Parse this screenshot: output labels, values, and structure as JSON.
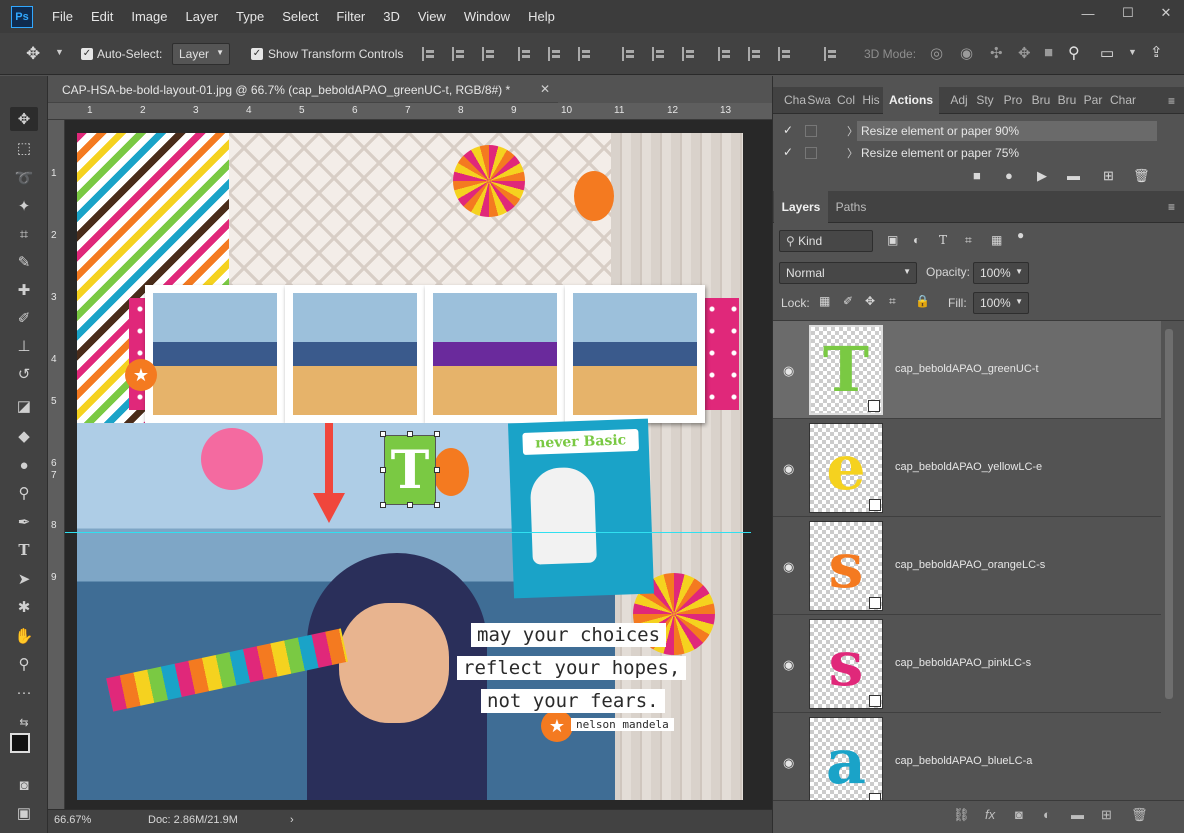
{
  "app": {
    "logo": "Ps"
  },
  "menu": [
    "File",
    "Edit",
    "Image",
    "Layer",
    "Type",
    "Select",
    "Filter",
    "3D",
    "View",
    "Window",
    "Help"
  ],
  "window_controls": {
    "minimize": "—",
    "maximize": "☐",
    "close": "✕"
  },
  "options": {
    "auto_select_label": "Auto-Select:",
    "auto_select_value": "Layer",
    "show_transform_label": "Show Transform Controls",
    "three_d_mode": "3D Mode:"
  },
  "document": {
    "tab_title": "CAP-HSA-be-bold-layout-01.jpg @ 66.7% (cap_beboldAPAO_greenUC-t, RGB/8#) *",
    "zoom": "66.67%",
    "doc_info": "Doc: 2.86M/21.9M",
    "ruler_top": [
      "1",
      "2",
      "3",
      "4",
      "5",
      "6",
      "7",
      "8",
      "9",
      "10",
      "11",
      "12",
      "13"
    ],
    "ruler_left": [
      "1",
      "2",
      "3",
      "4",
      "5",
      "6",
      "7",
      "8",
      "9"
    ]
  },
  "canvas": {
    "badge_text": "never Basic",
    "quote_lines": [
      "may your choices",
      "reflect your hopes,",
      "not your fears."
    ],
    "quote_author": "nelson mandela",
    "selected_letter": "T"
  },
  "panels": {
    "top_tabs": [
      "Cha",
      "Swa",
      "Col",
      "His",
      "Actions",
      "Adj",
      "Sty",
      "Pro",
      "Bru",
      "Bru",
      "Par",
      "Char"
    ],
    "active_top_tab": "Actions",
    "actions": [
      {
        "label": "Resize element or paper 90%"
      },
      {
        "label": "Resize element or paper 75%"
      }
    ],
    "layers_tabs": [
      "Layers",
      "Paths"
    ],
    "filter_kind": "Kind",
    "blend_mode": "Normal",
    "opacity_label": "Opacity:",
    "opacity_value": "100%",
    "lock_label": "Lock:",
    "fill_label": "Fill:",
    "fill_value": "100%",
    "layers": [
      {
        "name": "cap_beboldAPAO_greenUC-t",
        "letter": "T",
        "color": "#7ac943",
        "selected": true
      },
      {
        "name": "cap_beboldAPAO_yellowLC-e",
        "letter": "e",
        "color": "#f5d21f",
        "selected": false
      },
      {
        "name": "cap_beboldAPAO_orangeLC-s",
        "letter": "s",
        "color": "#f47a20",
        "selected": false
      },
      {
        "name": "cap_beboldAPAO_pinkLC-s",
        "letter": "s",
        "color": "#e0287a",
        "selected": false
      },
      {
        "name": "cap_beboldAPAO_blueLC-a",
        "letter": "a",
        "color": "#1aa3c8",
        "selected": false
      }
    ]
  },
  "colors": {
    "accent_red_arrow": "#f0463c",
    "guide_cyan": "#30e0f0",
    "balloon_orange": "#f47a20"
  }
}
